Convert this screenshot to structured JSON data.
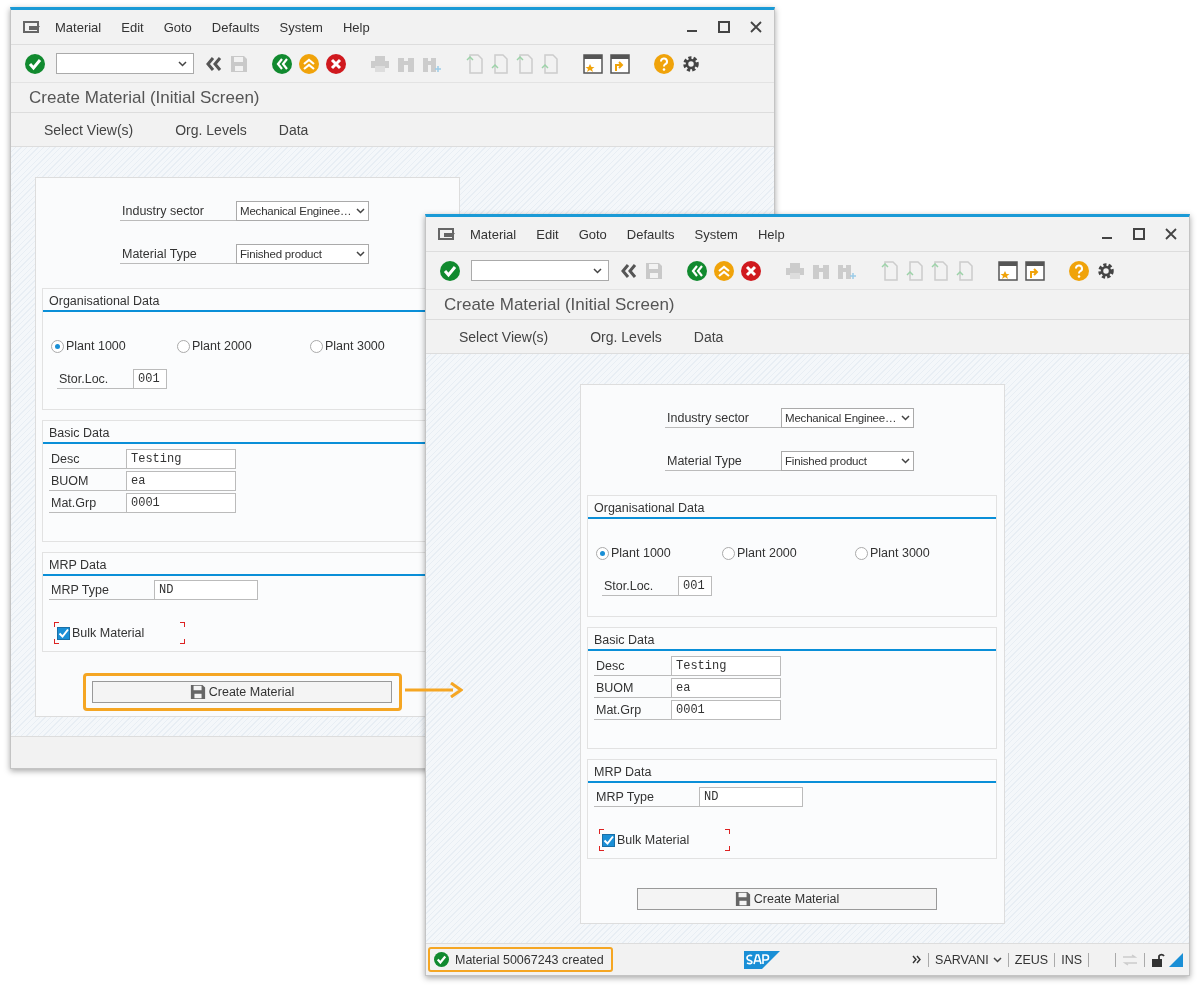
{
  "windows": [
    {
      "menu": [
        {
          "label": "Material"
        },
        {
          "label": "Edit"
        },
        {
          "label": "Goto"
        },
        {
          "label": "Defaults"
        },
        {
          "label": "System"
        },
        {
          "label": "Help"
        }
      ],
      "title": "Create Material (Initial Screen)",
      "tabs": [
        {
          "label": "Select View(s)"
        },
        {
          "label": "Org. Levels"
        },
        {
          "label": "Data"
        }
      ],
      "form": {
        "fields": [
          {
            "label": "Industry sector",
            "value": "Mechanical Enginee…"
          },
          {
            "label": "Material Type",
            "value": "Finished product"
          }
        ],
        "groups": [
          {
            "title": "Organisational Data",
            "radios": [
              {
                "label": "Plant 1000",
                "selected": true
              },
              {
                "label": "Plant 2000",
                "selected": false
              },
              {
                "label": "Plant 3000",
                "selected": false
              }
            ],
            "fields": [
              {
                "label": "Stor.Loc.",
                "value": "001"
              }
            ]
          },
          {
            "title": "Basic Data",
            "fields": [
              {
                "label": "Desc",
                "value": "Testing"
              },
              {
                "label": "BUOM",
                "value": "ea"
              },
              {
                "label": "Mat.Grp",
                "value": "0001"
              }
            ]
          },
          {
            "title": "MRP Data",
            "fields": [
              {
                "label": "MRP Type",
                "value": "ND"
              }
            ],
            "checkbox": {
              "label": "Bulk Material",
              "checked": true
            }
          }
        ],
        "button": {
          "label": "Create Material",
          "highlighted": true
        }
      }
    },
    {
      "menu": [
        {
          "label": "Material"
        },
        {
          "label": "Edit"
        },
        {
          "label": "Goto"
        },
        {
          "label": "Defaults"
        },
        {
          "label": "System"
        },
        {
          "label": "Help"
        }
      ],
      "title": "Create Material (Initial Screen)",
      "tabs": [
        {
          "label": "Select View(s)"
        },
        {
          "label": "Org. Levels"
        },
        {
          "label": "Data"
        }
      ],
      "form": {
        "fields": [
          {
            "label": "Industry sector",
            "value": "Mechanical Enginee…"
          },
          {
            "label": "Material Type",
            "value": "Finished product"
          }
        ],
        "groups": [
          {
            "title": "Organisational Data",
            "radios": [
              {
                "label": "Plant 1000",
                "selected": true
              },
              {
                "label": "Plant 2000",
                "selected": false
              },
              {
                "label": "Plant 3000",
                "selected": false
              }
            ],
            "fields": [
              {
                "label": "Stor.Loc.",
                "value": "001"
              }
            ]
          },
          {
            "title": "Basic Data",
            "fields": [
              {
                "label": "Desc",
                "value": "Testing"
              },
              {
                "label": "BUOM",
                "value": "ea"
              },
              {
                "label": "Mat.Grp",
                "value": "0001"
              }
            ]
          },
          {
            "title": "MRP Data",
            "fields": [
              {
                "label": "MRP Type",
                "value": "ND"
              }
            ],
            "checkbox": {
              "label": "Bulk Material",
              "checked": true
            }
          }
        ],
        "button": {
          "label": "Create Material",
          "highlighted": false
        }
      },
      "status_bar": {
        "message": "Material 50067243 created",
        "highlighted": true,
        "system": [
          "SARVANI",
          "ZEUS",
          "INS"
        ]
      }
    }
  ]
}
